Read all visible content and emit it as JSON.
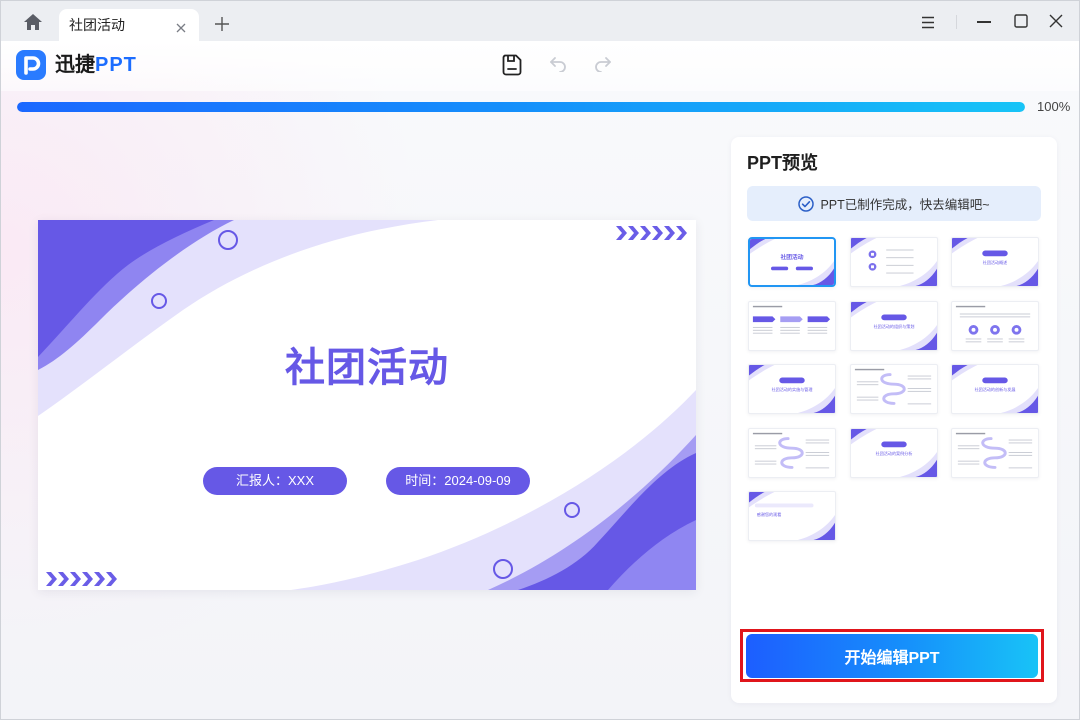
{
  "window": {
    "tab_title": "社团活动"
  },
  "header": {
    "brand_cn": "迅捷",
    "brand_en": "PPT"
  },
  "progress": {
    "value": 100,
    "label": "100%"
  },
  "slide": {
    "title": "社团活动",
    "reporter": "汇报人：XXX",
    "date": "时间：2024-09-09"
  },
  "panel": {
    "title": "PPT预览",
    "notice": "PPT已制作完成，快去编辑吧~",
    "thumbnails": [
      {
        "title": "社团活动",
        "selected": true
      },
      {},
      {
        "title": "社团活动概述"
      },
      {},
      {
        "title": "社团活动的组织与策划"
      },
      {},
      {
        "title": "社团活动的实施与管理"
      },
      {},
      {
        "title": "社团活动的创新与发展"
      },
      {},
      {
        "title": "社团活动的案例分析"
      },
      {},
      {
        "title": "感谢您的观看"
      }
    ],
    "edit_button": "开始编辑PPT"
  },
  "icons": [
    "home-icon",
    "tab-close-icon",
    "plus-icon",
    "menu-icon",
    "minimize-icon",
    "maximize-icon",
    "close-icon",
    "logo-icon",
    "save-icon",
    "undo-icon",
    "redo-icon",
    "check-circle-icon"
  ],
  "colors": {
    "accent": "#1d6fff",
    "slide_purple": "#6658e6",
    "annotation": "#e0151b"
  }
}
